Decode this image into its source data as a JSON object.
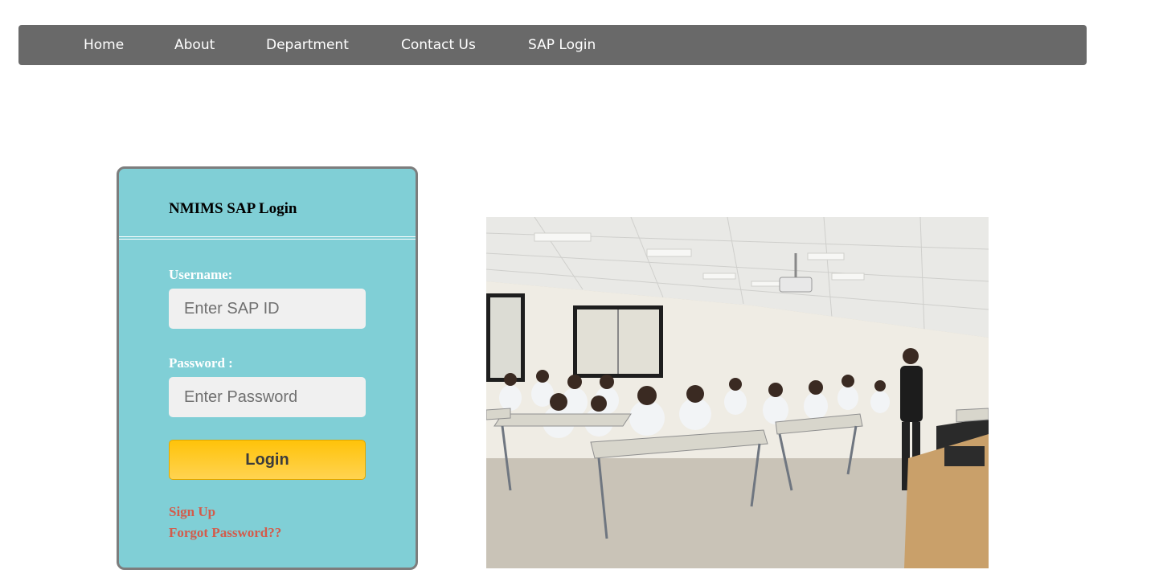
{
  "nav": {
    "items": [
      {
        "label": "Home"
      },
      {
        "label": "About"
      },
      {
        "label": "Department"
      },
      {
        "label": "Contact Us"
      },
      {
        "label": "SAP Login"
      }
    ]
  },
  "login": {
    "title": "NMIMS SAP Login",
    "username_label": "Username:",
    "username_placeholder": "Enter SAP ID",
    "password_label": "Password :",
    "password_placeholder": "Enter Password",
    "button_label": "Login",
    "signup_link": "Sign Up",
    "forgot_link": "Forgot Password??"
  },
  "colors": {
    "nav_bg": "#696969",
    "panel_bg": "#80cfd6",
    "button": "#ffc30a",
    "link": "#d35b4b"
  }
}
